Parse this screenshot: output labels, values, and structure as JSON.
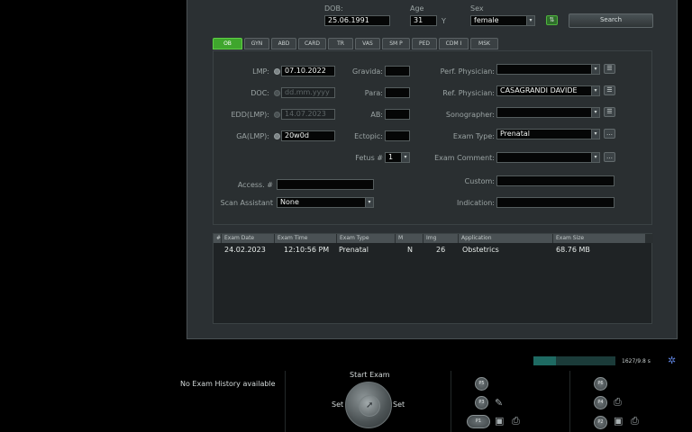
{
  "header": {
    "dob_label": "DOB:",
    "dob_value": "25.06.1991",
    "age_label": "Age",
    "age_value": "31",
    "age_unit": "Y",
    "sex_label": "Sex",
    "sex_value": "female",
    "search_label": "Search"
  },
  "tabs": [
    "OB",
    "GYN",
    "ABD",
    "CARD",
    "TR",
    "VAS",
    "SM P",
    "PED",
    "CDM I",
    "MSK"
  ],
  "active_tab": "OB",
  "ob_form": {
    "lmp_label": "LMP:",
    "lmp_value": "07.10.2022",
    "doc_label": "DOC:",
    "doc_placeholder": "dd.mm.yyyy",
    "edd_label": "EDD(LMP):",
    "edd_value": "14.07.2023",
    "ga_label": "GA(LMP):",
    "ga_value": "20w0d",
    "gravida_label": "Gravida:",
    "para_label": "Para:",
    "ab_label": "AB:",
    "ectopic_label": "Ectopic:",
    "fetus_label": "Fetus #",
    "fetus_value": "1",
    "access_label": "Access. #",
    "scan_assistant_label": "Scan Assistant",
    "scan_assistant_value": "None",
    "perf_physician_label": "Perf. Physician:",
    "ref_physician_label": "Ref. Physician:",
    "ref_physician_value": "CASAGRANDI DAVIDE",
    "sonographer_label": "Sonographer:",
    "exam_type_label": "Exam Type:",
    "exam_type_value": "Prenatal",
    "exam_comment_label": "Exam Comment:",
    "custom_label": "Custom:",
    "indication_label": "Indication:"
  },
  "exam_table": {
    "columns": [
      "#",
      "Exam Date",
      "Exam Time",
      "Exam Type",
      "M",
      "Img",
      "Application",
      "Exam Size"
    ],
    "rows": [
      [
        "",
        "24.02.2023",
        "12:10:56 PM",
        "Prenatal",
        "N",
        "26",
        "Obstetrics",
        "68.76 MB"
      ]
    ]
  },
  "status": {
    "storage_text": "1627/9.8 s",
    "storage_fraction": 0.28,
    "no_history": "No Exam History available",
    "start_exam": "Start Exam",
    "set_left": "Set",
    "set_right": "Set"
  },
  "keys": {
    "p5": "P5",
    "p3": "P3",
    "p1": "P1",
    "p6": "P6",
    "p4": "P4",
    "p2": "P2"
  },
  "colors": {
    "active_tab": "#3fa62d",
    "progress": "#1e6a62"
  }
}
